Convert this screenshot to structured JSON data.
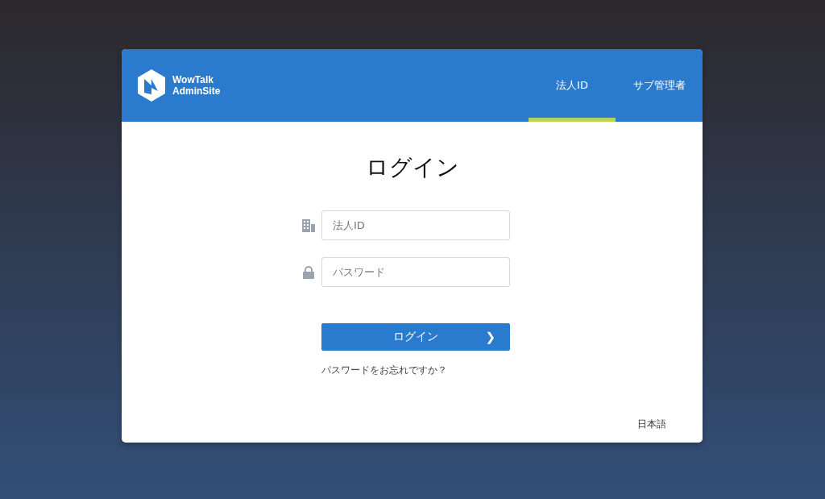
{
  "header": {
    "logo_line1": "WowTalk",
    "logo_line2": "AdminSite"
  },
  "tabs": [
    {
      "label": "法人ID",
      "selected": true
    },
    {
      "label": "サブ管理者",
      "selected": false
    }
  ],
  "title": "ログイン",
  "fields": [
    {
      "kind": "company",
      "placeholder": "法人ID"
    },
    {
      "kind": "password",
      "placeholder": "パスワード"
    }
  ],
  "login_button": {
    "label": "ログイン",
    "arrow": "❯"
  },
  "forgot_link": "パスワードをお忘れですか？",
  "language": "日本語"
}
